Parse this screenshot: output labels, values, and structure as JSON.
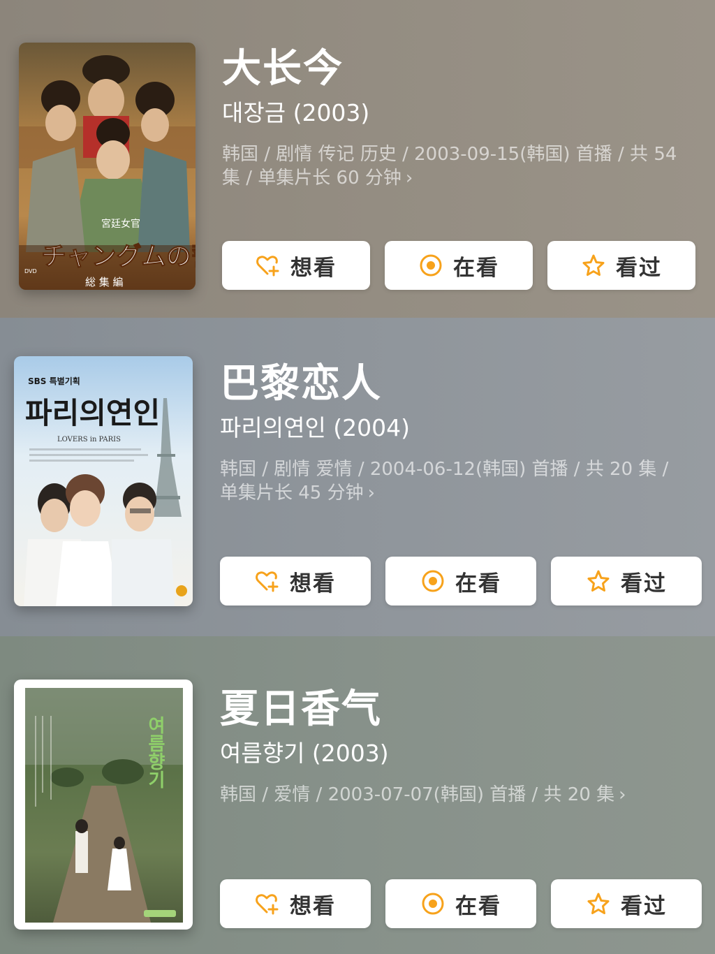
{
  "accent_color": "#f7a21b",
  "items": [
    {
      "title": "大长今",
      "subtitle": "대장금 (2003)",
      "meta": "韩国 / 剧情 传记 历史 / 2003-09-15(韩国) 首播 / 共 54 集 / 单集片长 60 分钟",
      "poster_text": {
        "top": "宮廷女官",
        "main": "チャングムの誓い",
        "bottom": "総 集 編",
        "dvd": "DVD"
      }
    },
    {
      "title": "巴黎恋人",
      "subtitle": "파리의연인 (2004)",
      "meta": "韩国 / 剧情 爱情 / 2004-06-12(韩国) 首播 / 共 20 集 / 单集片长 45 分钟",
      "poster_text": {
        "top": "SBS 특별기획",
        "main": "파리의연인",
        "bottom": "LOVERS in PARIS"
      }
    },
    {
      "title": "夏日香气",
      "subtitle": "여름향기 (2003)",
      "meta": "韩国 / 爱情 / 2003-07-07(韩国) 首播 / 共 20 集",
      "poster_text": {
        "main": "여름향기"
      }
    }
  ],
  "buttons": {
    "want": {
      "label": "想看",
      "icon": "heart-plus-icon"
    },
    "watching": {
      "label": "在看",
      "icon": "target-icon"
    },
    "watched": {
      "label": "看过",
      "icon": "star-icon"
    }
  }
}
